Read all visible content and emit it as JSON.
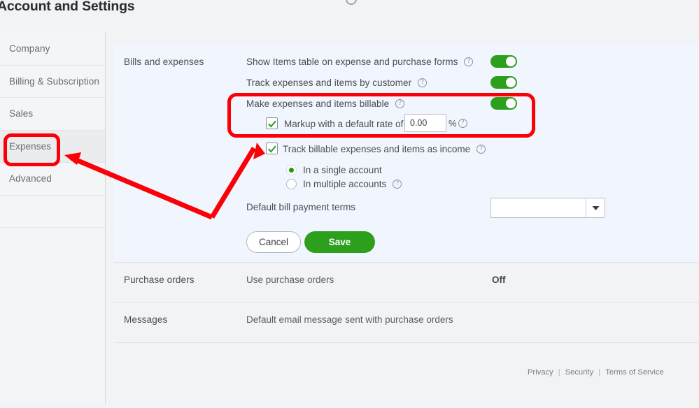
{
  "page": {
    "title": "Account and Settings"
  },
  "sidebar": {
    "items": [
      {
        "label": "Company",
        "active": false
      },
      {
        "label": "Billing & Subscription",
        "active": false
      },
      {
        "label": "Sales",
        "active": false
      },
      {
        "label": "Expenses",
        "active": true
      },
      {
        "label": "Advanced",
        "active": false
      }
    ]
  },
  "sections": {
    "bills": {
      "label": "Bills and expenses",
      "rows": [
        {
          "label": "Show Items table on expense and purchase forms",
          "help": "?",
          "toggle": "on"
        },
        {
          "label": "Track expenses and items by customer",
          "help": "?",
          "toggle": "on"
        },
        {
          "label": "Make expenses and items billable",
          "help": "?",
          "toggle": "on"
        }
      ],
      "markup": {
        "label": "Markup with a default rate of",
        "checked": true,
        "value": "0.00",
        "placeholder": "",
        "unit": "%",
        "help": "?"
      },
      "track_billable": {
        "label": "Track billable expenses and items as income",
        "checked": true,
        "help": "?"
      },
      "account_options": [
        {
          "label": "In a single account",
          "selected": true,
          "help": ""
        },
        {
          "label": "In multiple accounts",
          "selected": false,
          "help": "?"
        }
      ],
      "terms": {
        "label": "Default bill payment terms",
        "value": "",
        "placeholder": ""
      },
      "buttons": {
        "cancel": "Cancel",
        "save": "Save"
      }
    },
    "purchase_orders": {
      "label": "Purchase orders",
      "description": "Use purchase orders",
      "state": "Off"
    },
    "messages": {
      "label": "Messages",
      "description": "Default email message sent with purchase orders"
    }
  },
  "footer": {
    "privacy": "Privacy",
    "separator": "|",
    "security": "Security",
    "terms": "Terms of Service"
  },
  "colors": {
    "accent_green": "#2ca01c",
    "annotation_red": "#fb0007",
    "panel_background": "#f1f5fd",
    "page_background": "#f2f3f5"
  },
  "icons": {
    "help": "?",
    "chevron_down": "▼",
    "check": "✓"
  }
}
